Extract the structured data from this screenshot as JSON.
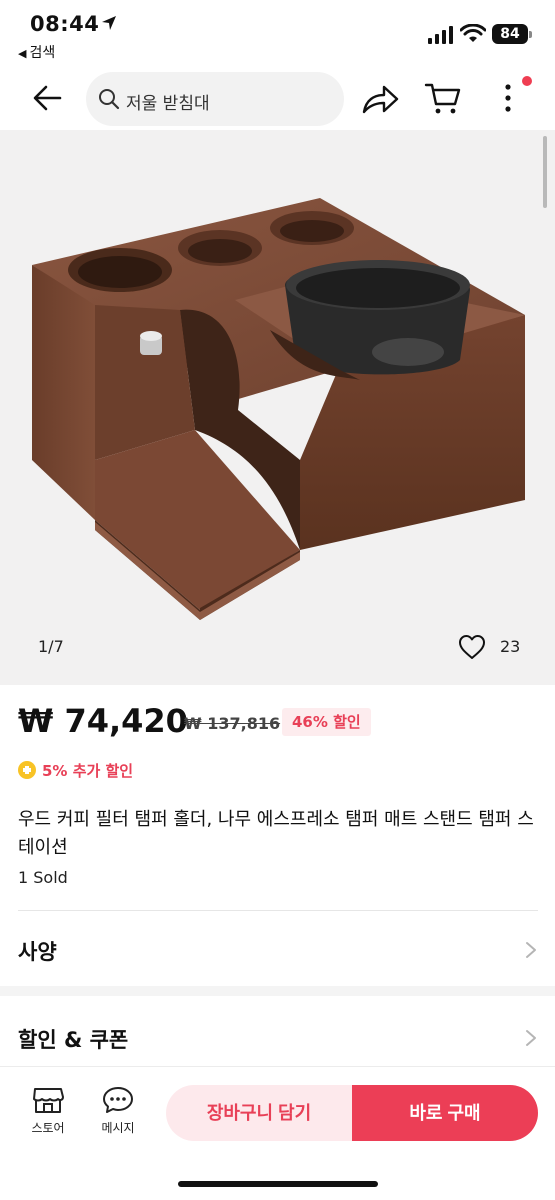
{
  "status_bar": {
    "time": "08:44",
    "back_app": "검색",
    "battery": "84"
  },
  "header": {
    "search_text": "저울 받침대"
  },
  "gallery": {
    "counter": "1/7",
    "likes": "23"
  },
  "product": {
    "price": "₩ 74,420",
    "original_price": "₩ 137,816",
    "discount": "46% 할인",
    "extra_discount": "5% 추가 할인",
    "title": "우드 커피 필터 탬퍼 홀더, 나무 에스프레소 탬퍼 매트 스탠드 탬퍼 스테이션",
    "sold": "1 Sold"
  },
  "sections": {
    "spec": "사양",
    "coupon": "할인 & 쿠폰"
  },
  "bottom_bar": {
    "store_label": "스토어",
    "message_label": "메시지",
    "cart_button": "장바구니 담기",
    "buy_button": "바로 구매"
  },
  "colors": {
    "accent": "#ec3e56",
    "accent_light": "#fde9ec",
    "discount_text": "#e84057",
    "coin": "#f8c326",
    "wood": "#7a4a36"
  }
}
